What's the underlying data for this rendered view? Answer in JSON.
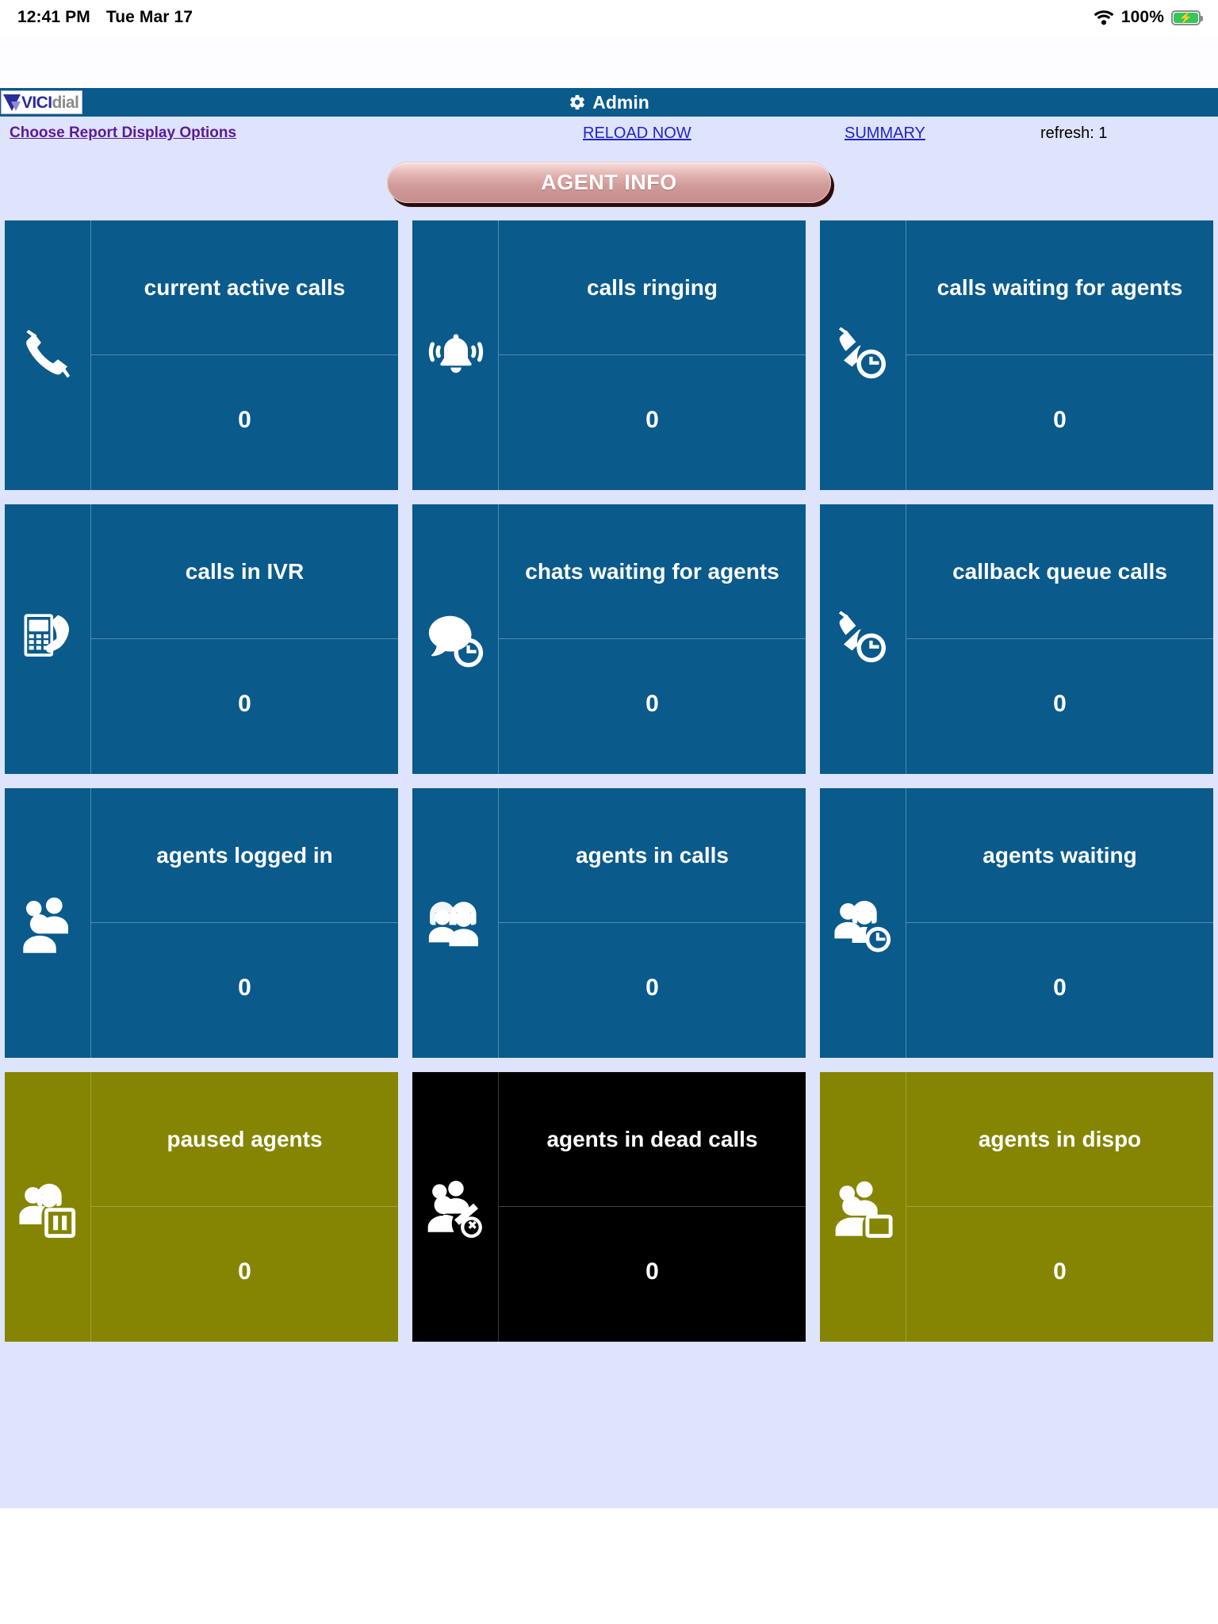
{
  "status_bar": {
    "time": "12:41 PM",
    "date": "Tue Mar 17",
    "battery_percent": "100%",
    "wifi_icon": "wifi-icon",
    "battery_icon": "battery-charging-icon"
  },
  "header": {
    "logo_vici": "VICI",
    "logo_dial": "dial",
    "title": "Admin",
    "gear_icon": "gear-icon",
    "bar_color": "#0a5a8c"
  },
  "options": {
    "choose_report": "Choose Report Display Options",
    "reload_now": "RELOAD NOW",
    "summary": "SUMMARY",
    "refresh": "refresh: 1"
  },
  "agent_info_button": {
    "label": "AGENT INFO",
    "color": "#cf9a98"
  },
  "colors": {
    "page_background": "#dde4fb",
    "tile_blue": "#0a5a8c",
    "tile_olive": "#858503",
    "tile_black": "#000000",
    "link_purple": "#5d1a99",
    "link_blue": "#2222cc"
  },
  "tiles": [
    {
      "label": "current active calls",
      "value": "0",
      "color": "blue",
      "icon": "phone-handset-icon"
    },
    {
      "label": "calls ringing",
      "value": "0",
      "color": "blue",
      "icon": "ringing-bell-icon"
    },
    {
      "label": "calls waiting for agents",
      "value": "0",
      "color": "blue",
      "icon": "phone-clock-icon"
    },
    {
      "label": "calls in IVR",
      "value": "0",
      "color": "blue",
      "icon": "ivr-keypad-phone-icon"
    },
    {
      "label": "chats waiting for agents",
      "value": "0",
      "color": "blue",
      "icon": "chat-bubble-clock-icon"
    },
    {
      "label": "callback queue calls",
      "value": "0",
      "color": "blue",
      "icon": "phone-clock-icon"
    },
    {
      "label": "agents logged in",
      "value": "0",
      "color": "blue",
      "icon": "users-group-icon"
    },
    {
      "label": "agents in calls",
      "value": "0",
      "color": "blue",
      "icon": "headset-agents-icon"
    },
    {
      "label": "agents waiting",
      "value": "0",
      "color": "blue",
      "icon": "agent-clock-icon"
    },
    {
      "label": "paused agents",
      "value": "0",
      "color": "olive",
      "icon": "agent-pause-icon"
    },
    {
      "label": "agents in dead calls",
      "value": "0",
      "color": "black",
      "icon": "agent-dead-call-icon"
    },
    {
      "label": "agents in dispo",
      "value": "0",
      "color": "olive",
      "icon": "agent-screen-icon"
    }
  ]
}
